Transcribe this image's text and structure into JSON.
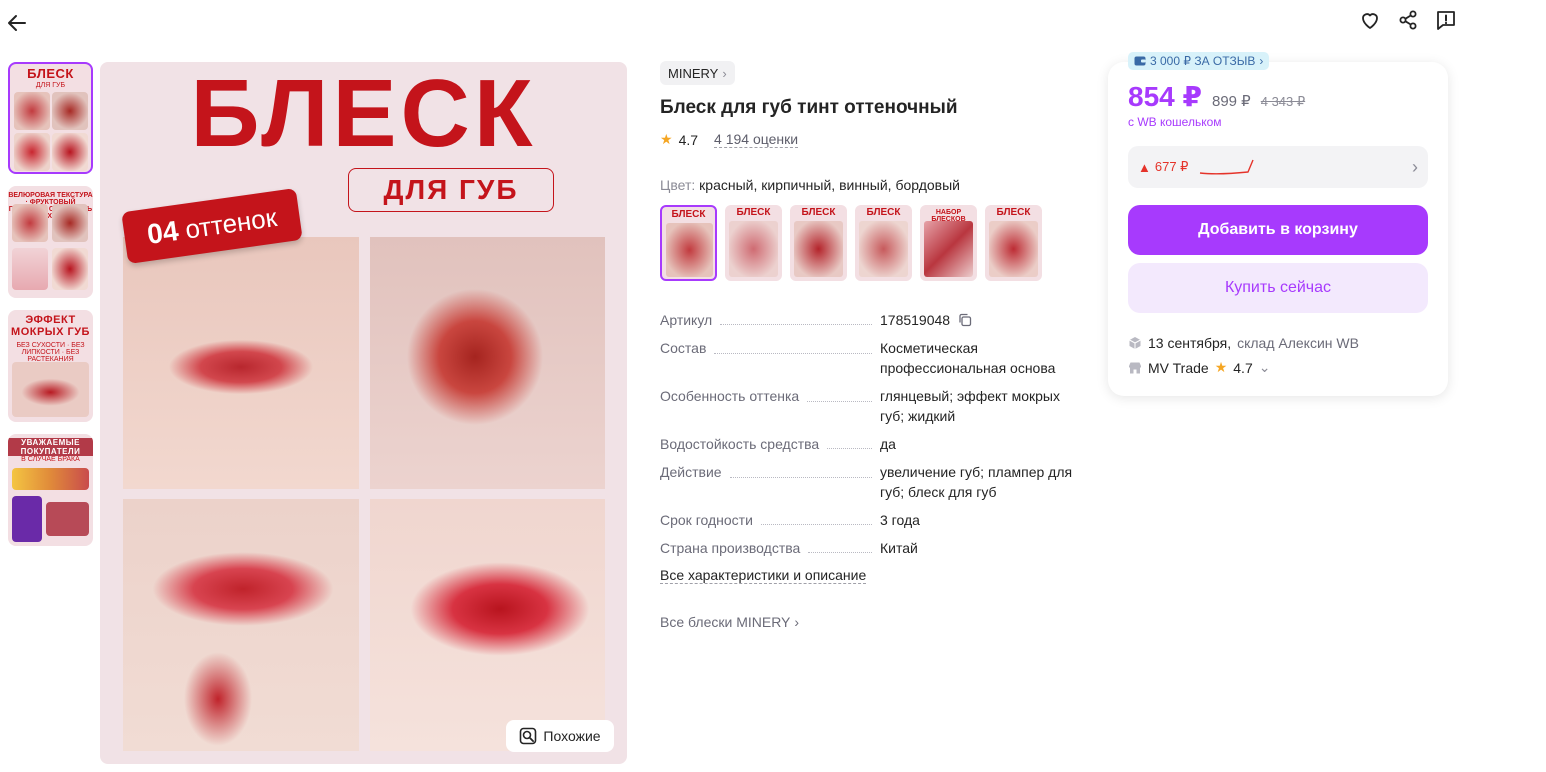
{
  "header": {
    "back_icon": "arrow-left-icon",
    "icons": [
      "heart-icon",
      "share-icon",
      "report-icon"
    ]
  },
  "gallery": {
    "thumbnails": [
      {
        "title": "БЛЕСК",
        "sub": "ДЛЯ ГУБ",
        "badge": "04 оттенок"
      },
      {
        "title": "",
        "sub": "ВЕЛЮРОВАЯ ТЕКСТУРА · ФРУКТОВЫЙ ПИГМЕНТ · СТОЙКОСТЬ · УХОД"
      },
      {
        "title": "ЭФФЕКТ МОКРЫХ ГУБ",
        "sub": "БЕЗ СУХОСТИ · БЕЗ ЛИПКОСТИ · БЕЗ РАСТЕКАНИЯ"
      },
      {
        "title": "УВАЖАЕМЫЕ ПОКУПАТЕЛИ",
        "sub": "В СЛУЧАЕ БРАКА"
      }
    ],
    "main": {
      "title": "БЛЕСК",
      "subtitle": "ДЛЯ ГУБ",
      "badge_number": "04",
      "badge_text": "оттенок"
    },
    "similar_label": "Похожие"
  },
  "product": {
    "brand": "MINERY",
    "title": "Блеск для губ тинт оттеночный",
    "rating": "4.7",
    "reviews": "4 194 оценки",
    "color_label": "Цвет:",
    "color_value": "красный, кирпичный, винный, бордовый",
    "color_variants": [
      "БЛЕСК",
      "БЛЕСК",
      "БЛЕСК",
      "БЛЕСК",
      "НАБОР БЛЕСКОВ",
      "БЛЕСК"
    ],
    "specs": [
      {
        "key": "Артикул",
        "value": "178519048"
      },
      {
        "key": "Состав",
        "value": "Косметическая профессиональная основа"
      },
      {
        "key": "Особенность оттенка",
        "value": "глянцевый; эффект мокрых губ; жидкий"
      },
      {
        "key": "Водостойкость средства",
        "value": "да"
      },
      {
        "key": "Действие",
        "value": "увеличение губ; пламп­ер для губ; блеск для губ"
      },
      {
        "key": "Срок годности",
        "value": "3 года"
      },
      {
        "key": "Страна производства",
        "value": "Китай"
      }
    ],
    "all_characteristics": "Все характеристики и описание",
    "all_brand_link": "Все блески MINERY"
  },
  "purchase": {
    "review_bonus": "3 000 ₽ ЗА ОТЗЫВ",
    "price": "854 ₽",
    "price_old": "899 ₽",
    "price_strike": "4 343 ₽",
    "wallet_note": "с WB кошельком",
    "history_value": "677 ₽",
    "add_to_cart": "Добавить в корзину",
    "buy_now": "Купить сейчас",
    "delivery_date": "13 сентября,",
    "warehouse": "склад Алексин WB",
    "seller_name": "MV Trade",
    "seller_rating": "4.7"
  },
  "colors": {
    "accent": "#a73afd",
    "brand_red": "#c4141b",
    "star": "#f5a623",
    "price_up": "#e5332a"
  }
}
